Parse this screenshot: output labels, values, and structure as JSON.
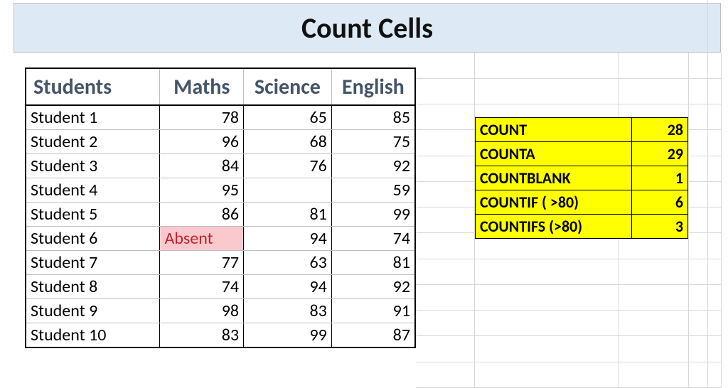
{
  "title": "Count Cells",
  "columns": [
    "Students",
    "Maths",
    "Science",
    "English"
  ],
  "rows": [
    {
      "student": "Student 1",
      "maths": "78",
      "science": "65",
      "english": "85"
    },
    {
      "student": "Student 2",
      "maths": "96",
      "science": "68",
      "english": "75"
    },
    {
      "student": "Student 3",
      "maths": "84",
      "science": "76",
      "english": "92"
    },
    {
      "student": "Student 4",
      "maths": "95",
      "science": "",
      "english": "59"
    },
    {
      "student": "Student 5",
      "maths": "86",
      "science": "81",
      "english": "99"
    },
    {
      "student": "Student 6",
      "maths": "Absent",
      "maths_flag": "absent",
      "science": "94",
      "english": "74"
    },
    {
      "student": "Student 7",
      "maths": "77",
      "science": "63",
      "english": "81"
    },
    {
      "student": "Student 8",
      "maths": "74",
      "science": "94",
      "english": "92"
    },
    {
      "student": "Student 9",
      "maths": "98",
      "science": "83",
      "english": "91"
    },
    {
      "student": "Student 10",
      "maths": "83",
      "science": "99",
      "english": "87"
    }
  ],
  "formulas": [
    {
      "label": "COUNT",
      "value": "28"
    },
    {
      "label": "COUNTA",
      "value": "29"
    },
    {
      "label": "COUNTBLANK",
      "value": "1"
    },
    {
      "label": "COUNTIF ( >80)",
      "value": "6"
    },
    {
      "label": "COUNTIFS (>80)",
      "value": "3"
    }
  ],
  "chart_data": {
    "type": "table",
    "title": "Count Cells",
    "columns": [
      "Students",
      "Maths",
      "Science",
      "English"
    ],
    "data": [
      [
        "Student 1",
        78,
        65,
        85
      ],
      [
        "Student 2",
        96,
        68,
        75
      ],
      [
        "Student 3",
        84,
        76,
        92
      ],
      [
        "Student 4",
        95,
        null,
        59
      ],
      [
        "Student 5",
        86,
        81,
        99
      ],
      [
        "Student 6",
        "Absent",
        94,
        74
      ],
      [
        "Student 7",
        77,
        63,
        81
      ],
      [
        "Student 8",
        74,
        94,
        92
      ],
      [
        "Student 9",
        98,
        83,
        91
      ],
      [
        "Student 10",
        83,
        99,
        87
      ]
    ],
    "summary": {
      "COUNT": 28,
      "COUNTA": 29,
      "COUNTBLANK": 1,
      "COUNTIF ( >80)": 6,
      "COUNTIFS (>80)": 3
    }
  }
}
